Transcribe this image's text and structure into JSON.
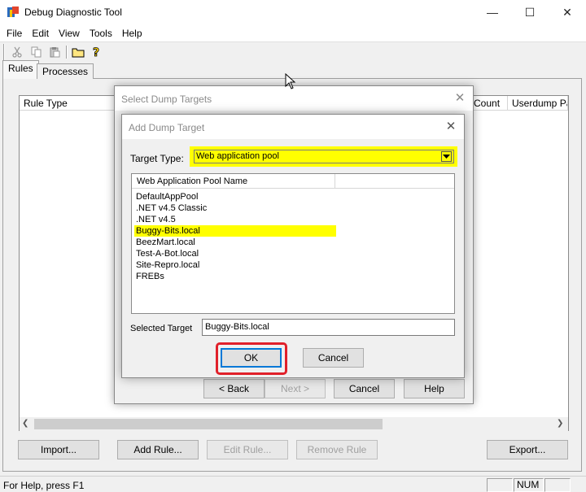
{
  "window": {
    "title": "Debug Diagnostic Tool",
    "controls": {
      "minimize": "—",
      "maximize": "☐",
      "close": "✕"
    }
  },
  "menu": [
    "File",
    "Edit",
    "View",
    "Tools",
    "Help"
  ],
  "toolbar": {
    "icons": [
      "scissors-icon",
      "copy-icon",
      "paste-icon",
      "folder-icon",
      "help-icon"
    ]
  },
  "tabs": [
    {
      "label": "Rules",
      "active": true
    },
    {
      "label": "Processes",
      "active": false
    }
  ],
  "rules_table": {
    "columns": [
      "Rule Type",
      "Count",
      "Userdump Pat"
    ]
  },
  "main_buttons": {
    "import": "Import...",
    "add_rule": "Add Rule...",
    "edit_rule": "Edit Rule...",
    "remove_rule": "Remove Rule",
    "export": "Export..."
  },
  "statusbar": {
    "text": "For Help, press F1",
    "num": "NUM"
  },
  "wizard": {
    "title": "Select Dump Targets",
    "close": "✕",
    "buttons": {
      "back": "< Back",
      "next": "Next >",
      "cancel": "Cancel",
      "help": "Help"
    }
  },
  "add_dump_target": {
    "title": "Add Dump Target",
    "close": "✕",
    "target_type_label": "Target Type:",
    "target_type_value": "Web application pool",
    "list_header": "Web Application Pool Name",
    "pools": [
      "DefaultAppPool",
      ".NET v4.5 Classic",
      ".NET v4.5",
      "Buggy-Bits.local",
      "BeezMart.local",
      "Test-A-Bot.local",
      "Site-Repro.local",
      "FREBs"
    ],
    "selected_index": 3,
    "selected_target_label": "Selected Target",
    "selected_target_value": "Buggy-Bits.local",
    "ok": "OK",
    "cancel": "Cancel"
  },
  "colors": {
    "highlight": "#ffff00",
    "annotation_red": "#e0202a",
    "accent_blue": "#0078d7"
  }
}
